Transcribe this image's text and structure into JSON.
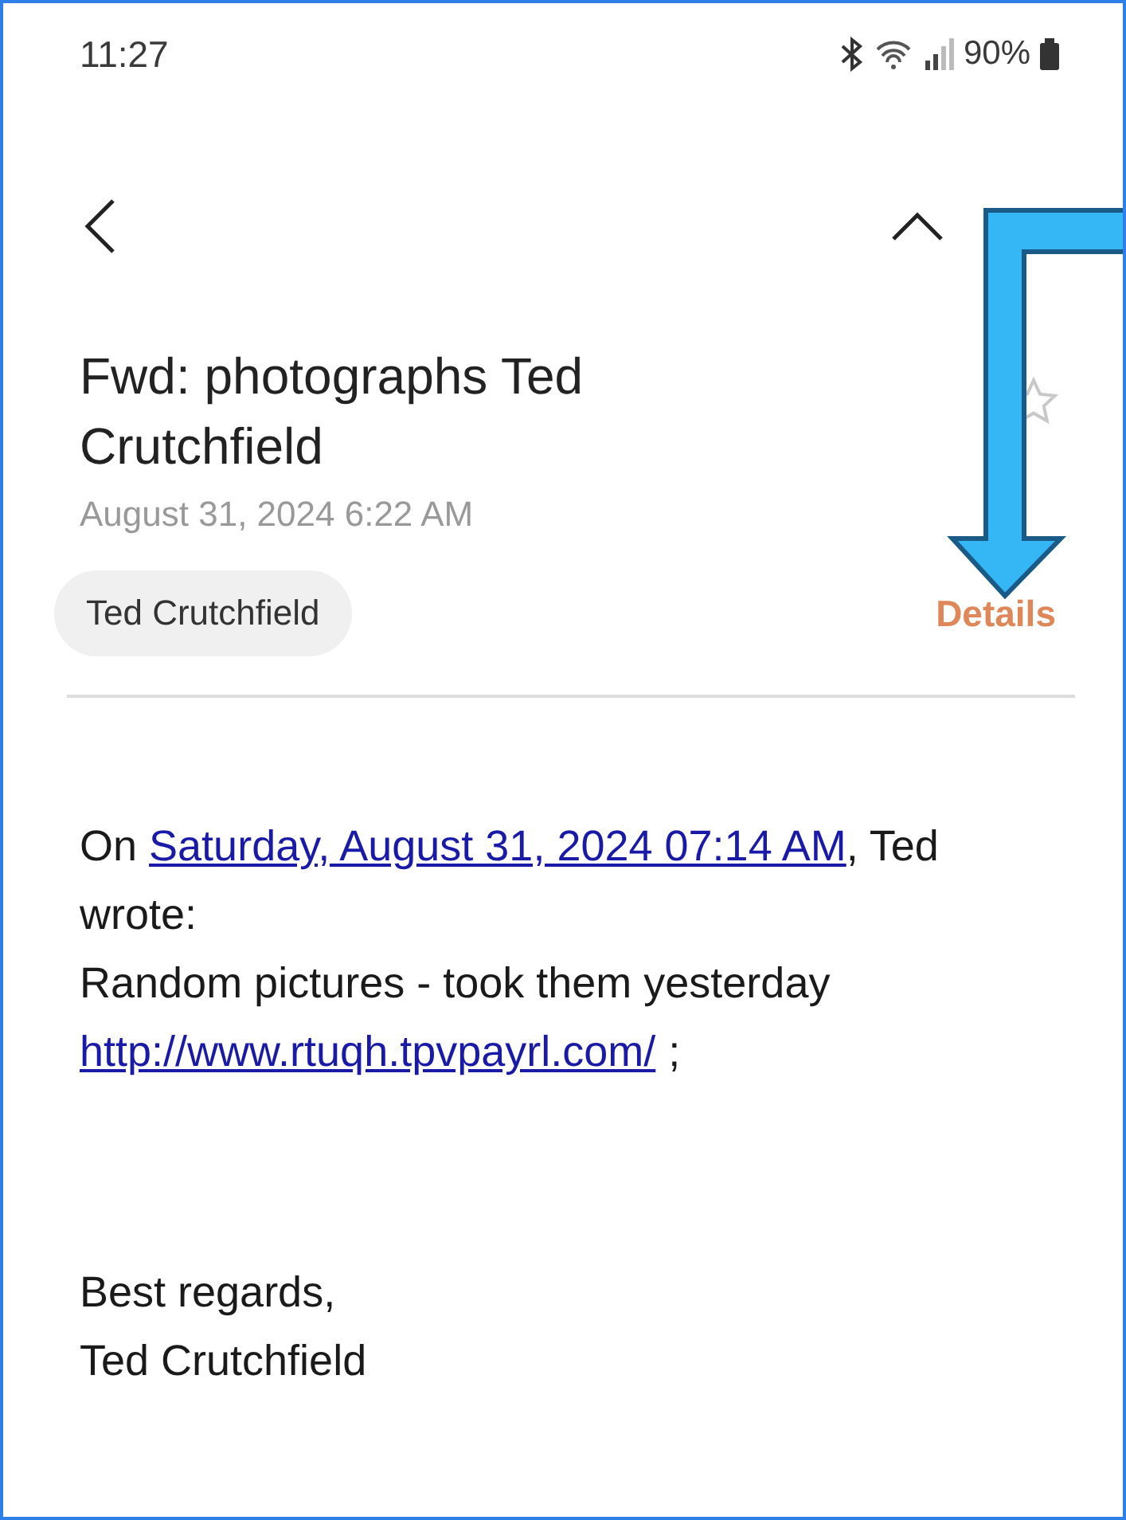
{
  "status_bar": {
    "time": "11:27",
    "battery": "90%"
  },
  "email": {
    "subject": "Fwd: photographs Ted Crutchfield",
    "starred": false,
    "date": "August 31, 2024  6:22 AM",
    "sender": "Ted Crutchfield",
    "details": "Details"
  },
  "message": {
    "intro_prefix": "On ",
    "intro_link": "Saturday, August 31, 2024 07:14 AM",
    "intro_suffix": ", Ted wrote:",
    "text": "Random pictures - took them yesterday",
    "url": "http://www.rtuqh.tpvpayrl.com/",
    "url_suffix": ";",
    "signoff": "Best regards,",
    "signature": "Ted Crutchfield"
  }
}
